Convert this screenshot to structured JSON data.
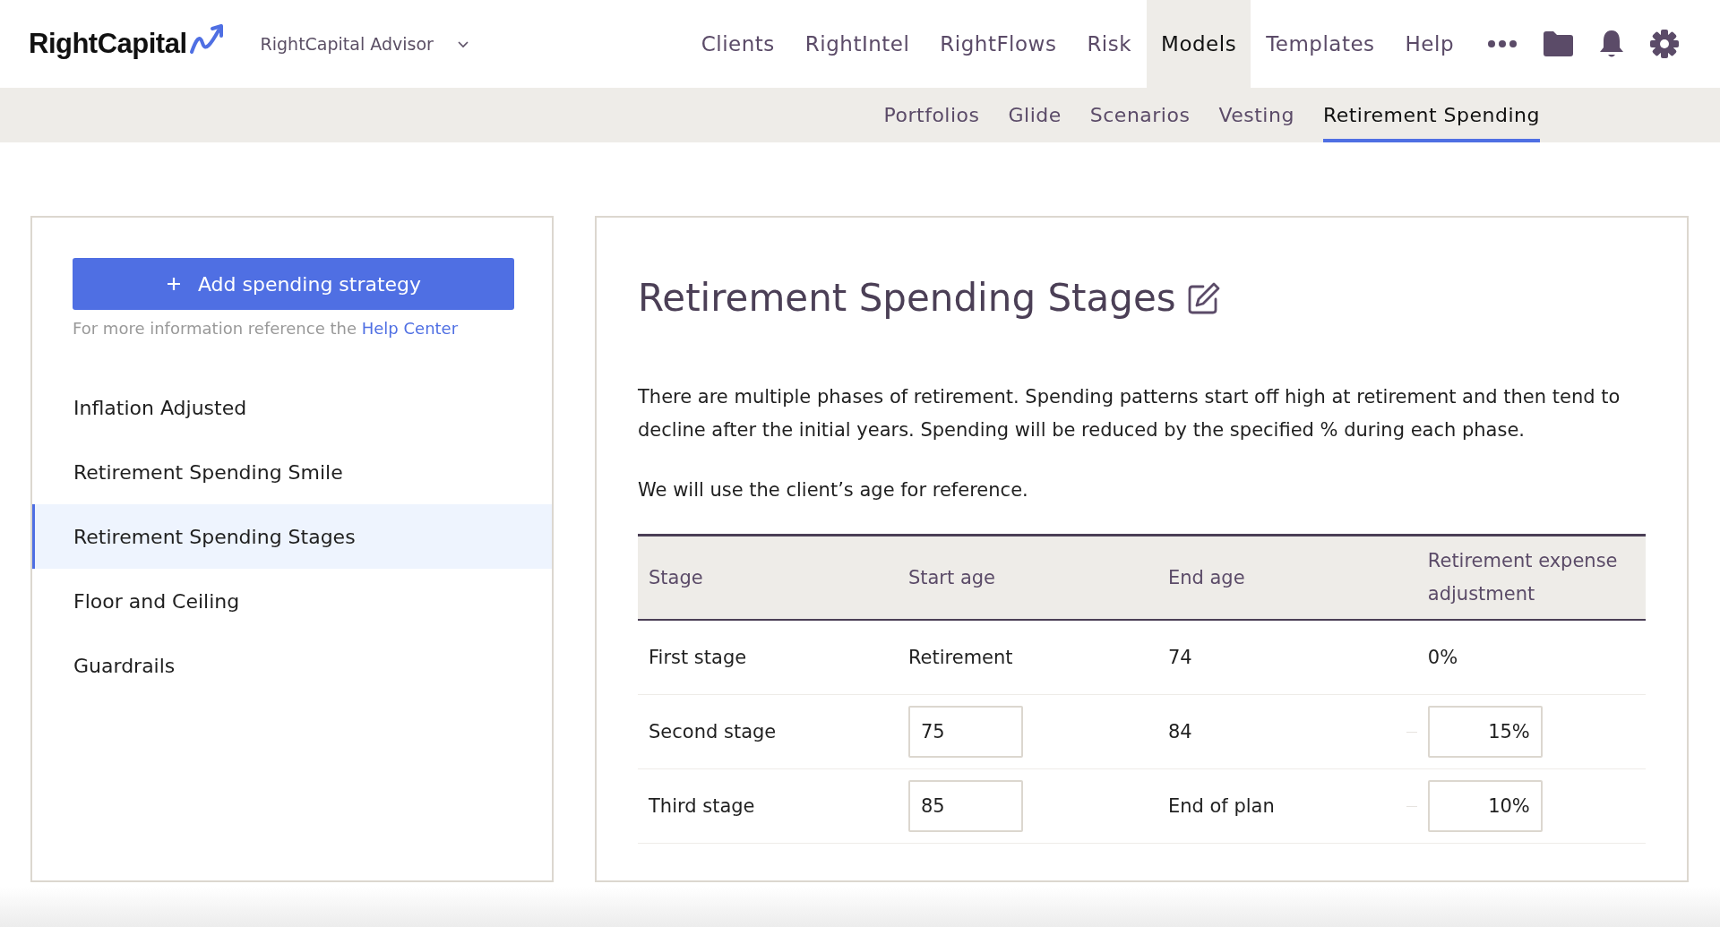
{
  "brand": {
    "name": "RightCapital"
  },
  "account": {
    "label": "RightCapital Advisor"
  },
  "nav": [
    {
      "label": "Clients",
      "selected": false
    },
    {
      "label": "RightIntel",
      "selected": false
    },
    {
      "label": "RightFlows",
      "selected": false
    },
    {
      "label": "Risk",
      "selected": false
    },
    {
      "label": "Models",
      "selected": true
    },
    {
      "label": "Templates",
      "selected": false
    },
    {
      "label": "Help",
      "selected": false
    }
  ],
  "subnav": [
    {
      "label": "Portfolios",
      "selected": false
    },
    {
      "label": "Glide",
      "selected": false
    },
    {
      "label": "Scenarios",
      "selected": false
    },
    {
      "label": "Vesting",
      "selected": false
    },
    {
      "label": "Retirement Spending",
      "selected": true
    }
  ],
  "sidebar": {
    "add_button": "Add spending strategy",
    "help_text": "For more information reference the",
    "help_link": "Help Center",
    "items": [
      {
        "label": "Inflation Adjusted",
        "selected": false
      },
      {
        "label": "Retirement Spending Smile",
        "selected": false
      },
      {
        "label": "Retirement Spending Stages",
        "selected": true
      },
      {
        "label": "Floor and Ceiling",
        "selected": false
      },
      {
        "label": "Guardrails",
        "selected": false
      }
    ]
  },
  "main": {
    "title": "Retirement Spending Stages",
    "paragraphs": [
      "There are multiple phases of retirement. Spending patterns start off high at retirement and then tend to decline after the initial years. Spending will be reduced by the specified % during each phase.",
      "We will use the client’s age for reference."
    ],
    "table": {
      "columns": [
        "Stage",
        "Start age",
        "End age",
        "Retirement expense adjustment"
      ],
      "rows": [
        [
          {
            "kind": "text",
            "value": "First stage"
          },
          {
            "kind": "text",
            "value": "Retirement"
          },
          {
            "kind": "text",
            "value": "74"
          },
          {
            "kind": "text",
            "value": "0%"
          }
        ],
        [
          {
            "kind": "text",
            "value": "Second stage"
          },
          {
            "kind": "input",
            "value": "75"
          },
          {
            "kind": "text",
            "value": "84"
          },
          {
            "kind": "percent",
            "value": "15%"
          }
        ],
        [
          {
            "kind": "text",
            "value": "Third stage"
          },
          {
            "kind": "input",
            "value": "85"
          },
          {
            "kind": "text",
            "value": "End of plan"
          },
          {
            "kind": "percent",
            "value": "10%"
          }
        ]
      ]
    }
  }
}
